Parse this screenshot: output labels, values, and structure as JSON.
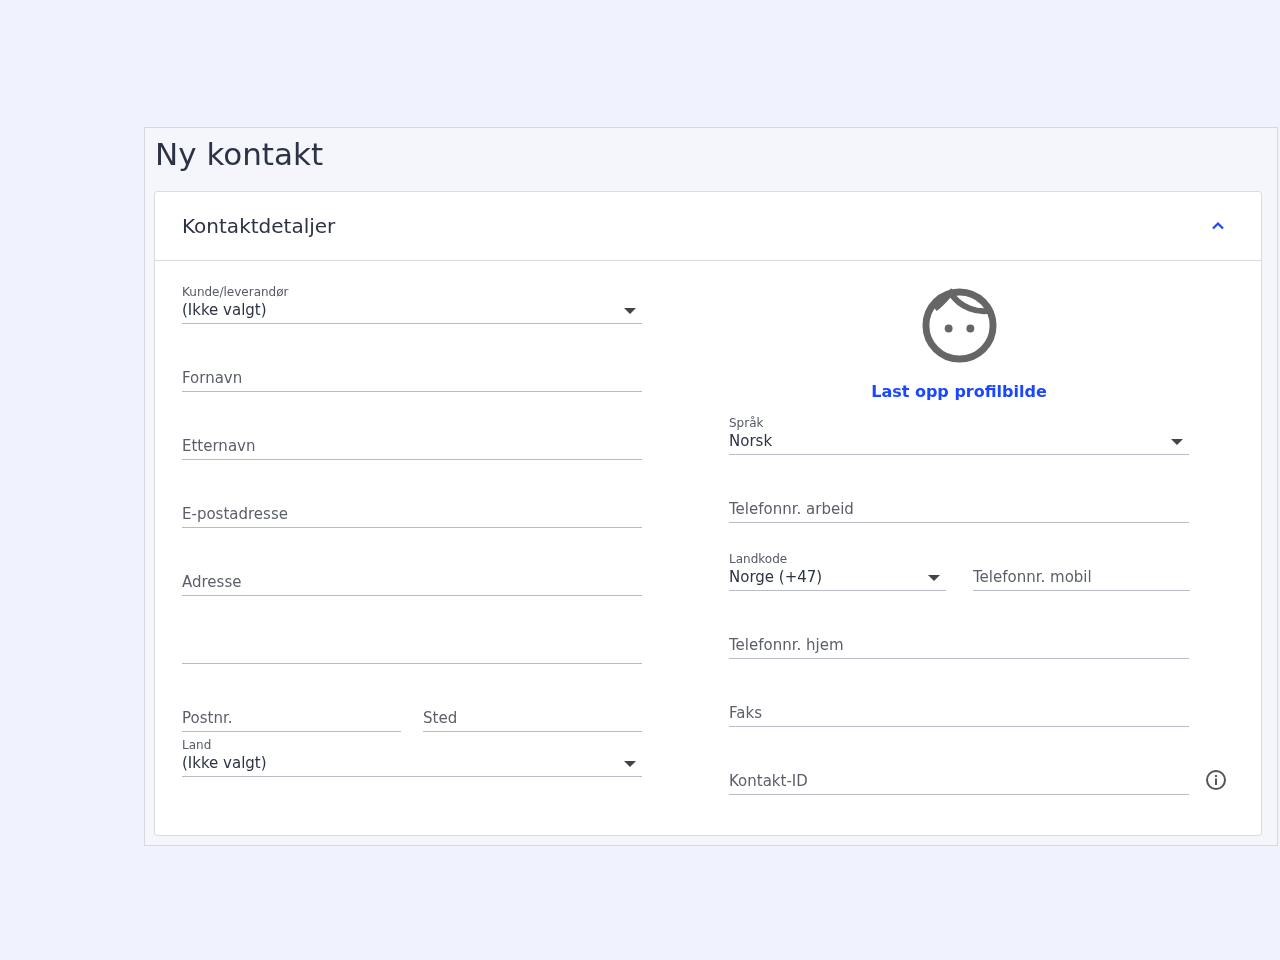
{
  "page": {
    "title": "Ny kontakt"
  },
  "section": {
    "title": "Kontaktdetaljer",
    "expanded": true
  },
  "left_column": [
    {
      "kind": "select",
      "label": "Kunde/leverandør",
      "value": "(Ikke valgt)"
    },
    {
      "kind": "text",
      "placeholder": "Fornavn"
    },
    {
      "kind": "text",
      "placeholder": "Etternavn"
    },
    {
      "kind": "text",
      "placeholder": "E-postadresse"
    },
    {
      "kind": "text",
      "placeholder": "Adresse"
    },
    {
      "kind": "text"
    },
    {
      "kind": "pair",
      "fields": [
        {
          "kind": "text",
          "placeholder": "Postnr."
        },
        {
          "kind": "text",
          "placeholder": "Sted"
        }
      ]
    },
    {
      "kind": "select",
      "label": "Land",
      "value": "(Ikke valgt)"
    }
  ],
  "right_column": [
    {
      "kind": "avatar",
      "link": "Last opp profilbilde"
    },
    {
      "kind": "select",
      "label": "Språk",
      "value": "Norsk"
    },
    {
      "kind": "text",
      "placeholder": "Telefonnr. arbeid"
    },
    {
      "kind": "pair",
      "fields": [
        {
          "kind": "select",
          "label": "Landkode",
          "value": "Norge (+47)"
        },
        {
          "kind": "text",
          "placeholder": "Telefonnr. mobil"
        }
      ]
    },
    {
      "kind": "text",
      "placeholder": "Telefonnr. hjem"
    },
    {
      "kind": "text",
      "placeholder": "Faks"
    },
    {
      "kind": "text",
      "placeholder": "Kontakt-ID",
      "help": true
    }
  ]
}
